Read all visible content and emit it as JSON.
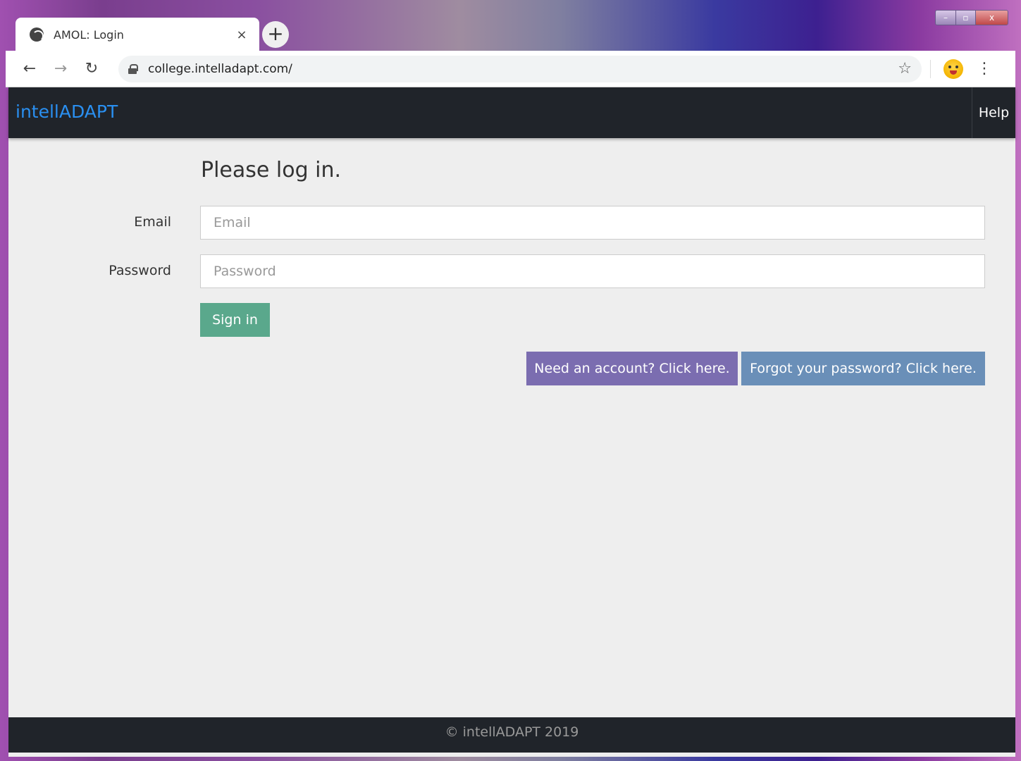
{
  "browser": {
    "tab_title": "AMOL: Login",
    "tab_close": "×",
    "new_tab": "+",
    "url": "college.intelladapt.com/",
    "star": "☆",
    "menu": "⋮",
    "back": "←",
    "forward": "→",
    "reload": "↻"
  },
  "navbar": {
    "brand": "intellADAPT",
    "help": "Help"
  },
  "form": {
    "heading": "Please log in.",
    "email_label": "Email",
    "email_placeholder": "Email",
    "email_value": "",
    "password_label": "Password",
    "password_placeholder": "Password",
    "password_value": "",
    "signin_label": "Sign in",
    "account_label": "Need an account? Click here.",
    "forgot_label": "Forgot your password? Click here."
  },
  "footer": {
    "text": "© intellADAPT 2019"
  },
  "colors": {
    "navbar_bg": "#20242a",
    "brand": "#2a8ff0",
    "signin": "#5aa88c",
    "account": "#7b6db0",
    "forgot": "#6a8fb8",
    "page_bg": "#eeeeee"
  }
}
